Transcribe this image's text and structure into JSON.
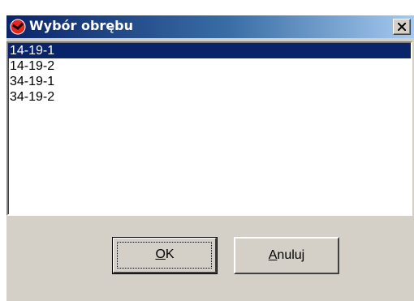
{
  "window": {
    "title": "Wybór obrębu",
    "icon": "app-red-circle-icon",
    "close_icon": "close-icon"
  },
  "list": {
    "items": [
      "14-19-1",
      "14-19-2",
      "34-19-1",
      "34-19-2"
    ],
    "selected_index": 0
  },
  "buttons": {
    "ok": {
      "mnemonic": "O",
      "rest": "K"
    },
    "cancel": {
      "mnemonic": "A",
      "rest": "nuluj"
    }
  },
  "colors": {
    "title_start": "#0a246a",
    "title_end": "#a6caf0",
    "selection": "#0a246a",
    "face": "#d4d0c8"
  }
}
